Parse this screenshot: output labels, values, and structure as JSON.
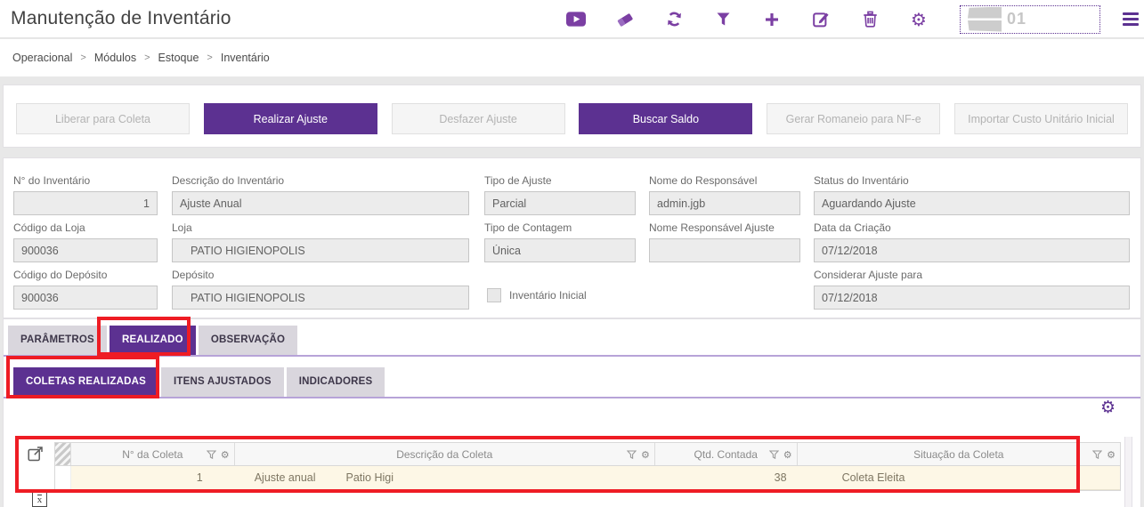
{
  "theme": {
    "primary_purple": "#5c3191",
    "icon_purple": "#7b3fa3",
    "annotation_red": "#ee1c24",
    "row_highlight": "#fdf7e6",
    "tab_inactive_bg": "#d9d6dd"
  },
  "header": {
    "title": "Manutenção de Inventário",
    "record_badge": "01",
    "toolbar_icon_names": [
      "video-play",
      "eraser",
      "refresh",
      "filter",
      "add",
      "edit",
      "delete",
      "settings"
    ]
  },
  "icons": {
    "gear_glyph": "⚙",
    "xls_letter": "x"
  },
  "breadcrumb": {
    "separator": ">",
    "items": [
      "Operacional",
      "Módulos",
      "Estoque",
      "Inventário"
    ]
  },
  "actions": [
    {
      "label": "Liberar para Coleta",
      "enabled": false
    },
    {
      "label": "Realizar Ajuste",
      "enabled": true
    },
    {
      "label": "Desfazer Ajuste",
      "enabled": false
    },
    {
      "label": "Buscar Saldo",
      "enabled": true
    },
    {
      "label": "Gerar Romaneio para NF-e",
      "enabled": false
    },
    {
      "label": "Importar Custo Unitário Inicial",
      "enabled": false
    }
  ],
  "form": {
    "num_inventario": {
      "label": "N° do Inventário",
      "value": "1"
    },
    "descricao_inventario": {
      "label": "Descrição do Inventário",
      "value": "Ajuste Anual"
    },
    "tipo_ajuste": {
      "label": "Tipo de Ajuste",
      "value": "Parcial"
    },
    "nome_responsavel": {
      "label": "Nome do Responsável",
      "value": "admin.jgb"
    },
    "status_inventario": {
      "label": "Status do Inventário",
      "value": "Aguardando Ajuste"
    },
    "codigo_loja": {
      "label": "Código da Loja",
      "value": "900036"
    },
    "loja": {
      "label": "Loja",
      "value": "PATIO HIGIENOPOLIS"
    },
    "tipo_contagem": {
      "label": "Tipo de Contagem",
      "value": "Única"
    },
    "nome_responsavel_ajuste": {
      "label": "Nome Responsável Ajuste",
      "value": ""
    },
    "data_criacao": {
      "label": "Data da Criação",
      "value": "07/12/2018"
    },
    "codigo_deposito": {
      "label": "Código do Depósito",
      "value": "900036"
    },
    "deposito": {
      "label": "Depósito",
      "value": "PATIO HIGIENOPOLIS"
    },
    "inventario_inicial": {
      "label": "Inventário Inicial",
      "checked": false
    },
    "considerar_ajuste_para": {
      "label": "Considerar Ajuste para",
      "value": "07/12/2018"
    }
  },
  "tabs": {
    "main": [
      {
        "label": "PARÂMETROS",
        "active": false
      },
      {
        "label": "REALIZADO",
        "active": true
      },
      {
        "label": "OBSERVAÇÃO",
        "active": false
      }
    ],
    "sub": [
      {
        "label": "COLETAS REALIZADAS",
        "active": true
      },
      {
        "label": "ITENS AJUSTADOS",
        "active": false
      },
      {
        "label": "INDICADORES",
        "active": false
      }
    ]
  },
  "grid": {
    "columns": [
      {
        "label": "N° da Coleta"
      },
      {
        "label": "Descrição da Coleta"
      },
      {
        "label": "Qtd. Contada"
      },
      {
        "label": "Situação da Coleta"
      }
    ],
    "row": {
      "num_coleta": "1",
      "descricao": "Ajuste anual",
      "descricao_loja": "Patio Higi",
      "qtd_contada": "38",
      "situacao": "Coleta Eleita"
    }
  }
}
